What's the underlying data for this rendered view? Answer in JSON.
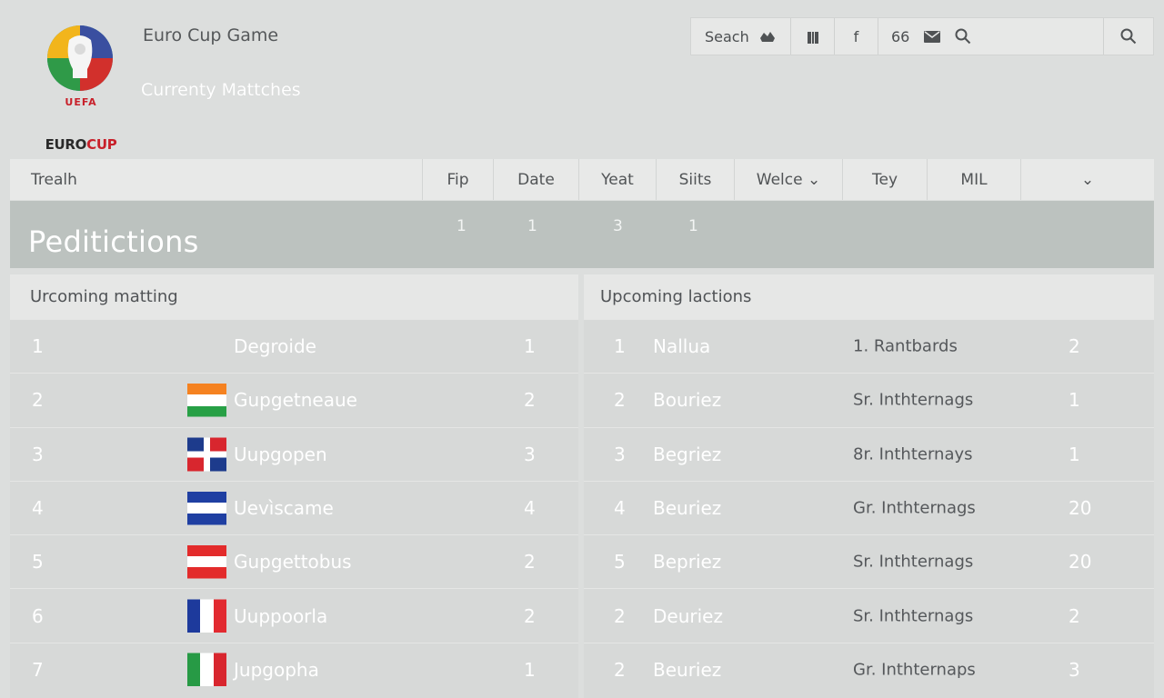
{
  "header": {
    "app_title": "Euro Cup Game",
    "subtitle": "Currenty Mattches",
    "logo": {
      "uefa": "UEFA",
      "euro": "EURO",
      "cup": "CUP",
      "icon": "trophy-emblem-icon"
    }
  },
  "toolbar": {
    "search_label": "Seach",
    "items": [
      {
        "icon": "cloud-icon"
      },
      {
        "icon": "bookmark-icon"
      },
      {
        "label": "f",
        "icon": "facebook-icon"
      },
      {
        "label": "66",
        "icon": "mail-icon"
      }
    ],
    "search_button_icon": "search-icon"
  },
  "columns": {
    "first": "Trealh",
    "items": [
      "Fip",
      "Date",
      "Yeat",
      "Siits",
      "Welce ⌄",
      "Tey",
      "MIL",
      "⌄"
    ]
  },
  "banner": {
    "title": "Peditictions",
    "numbers": [
      "1",
      "1",
      "3",
      "1"
    ]
  },
  "left_panel": {
    "title": "Urcoming matting",
    "rows": [
      {
        "num": "1",
        "name": "Degroide",
        "score": "1",
        "flag": null
      },
      {
        "num": "2",
        "name": "Gupgetneaue",
        "score": "2",
        "flag": {
          "dir": "h",
          "colors": [
            "#f58220",
            "#ffffff",
            "#27a045"
          ]
        }
      },
      {
        "num": "3",
        "name": "Uupgopen",
        "score": "3",
        "flag": {
          "dir": "cross",
          "colors": [
            "#1d3b8c",
            "#ffffff",
            "#d8262e"
          ]
        }
      },
      {
        "num": "4",
        "name": "Uevìscame",
        "score": "4",
        "flag": {
          "dir": "h",
          "colors": [
            "#1f3fa2",
            "#ffffff",
            "#1f3fa2"
          ]
        }
      },
      {
        "num": "5",
        "name": "Gupgettobus",
        "score": "2",
        "flag": {
          "dir": "h",
          "colors": [
            "#e32b2b",
            "#ffffff",
            "#e32b2b"
          ]
        }
      },
      {
        "num": "6",
        "name": "Uuppoorla",
        "score": "2",
        "flag": {
          "dir": "v",
          "colors": [
            "#1d3a9c",
            "#ffffff",
            "#e22a30"
          ]
        }
      },
      {
        "num": "7",
        "name": "Jupgopha",
        "score": "1",
        "flag": {
          "dir": "v",
          "colors": [
            "#279a45",
            "#ffffff",
            "#d8262e"
          ]
        }
      }
    ]
  },
  "right_panel": {
    "title": "Upcoming lactions",
    "rows": [
      {
        "num": "1",
        "name": "Nallua",
        "detail": "1. Rantbards",
        "value": "2"
      },
      {
        "num": "2",
        "name": "Bouriez",
        "detail": "Sr. Inthternags",
        "value": "1"
      },
      {
        "num": "3",
        "name": "Begriez",
        "detail": "8r. Inthternays",
        "value": "1"
      },
      {
        "num": "4",
        "name": "Beuriez",
        "detail": "Gr. Inthternags",
        "value": "20"
      },
      {
        "num": "5",
        "name": "Bepriez",
        "detail": "Sr. Inthternags",
        "value": "20"
      },
      {
        "num": "2",
        "name": "Deuriez",
        "detail": "Sr. Inthternags",
        "value": "2"
      },
      {
        "num": "2",
        "name": "Beuriez",
        "detail": "Gr. Inthternaps",
        "value": "3"
      }
    ]
  }
}
